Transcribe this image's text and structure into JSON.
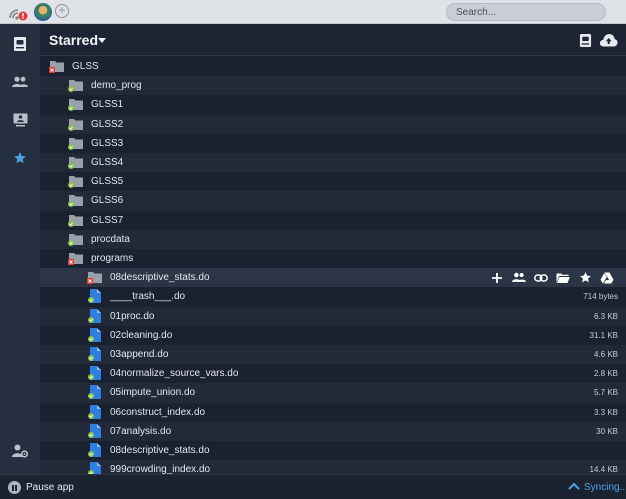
{
  "app": {
    "search": {
      "placeholder": "Search...",
      "value": ""
    }
  },
  "header": {
    "title": "Starred"
  },
  "rows": [
    {
      "label": "GLSS",
      "type": "folder",
      "status": "error",
      "size": ""
    },
    {
      "label": "demo_prog",
      "type": "folder",
      "status": "ok",
      "size": ""
    },
    {
      "label": "GLSS1",
      "type": "folder",
      "status": "ok",
      "size": ""
    },
    {
      "label": "GLSS2",
      "type": "folder",
      "status": "ok",
      "size": ""
    },
    {
      "label": "GLSS3",
      "type": "folder",
      "status": "ok",
      "size": ""
    },
    {
      "label": "GLSS4",
      "type": "folder",
      "status": "ok",
      "size": ""
    },
    {
      "label": "GLSS5",
      "type": "folder",
      "status": "ok",
      "size": ""
    },
    {
      "label": "GLSS6",
      "type": "folder",
      "status": "ok",
      "size": ""
    },
    {
      "label": "GLSS7",
      "type": "folder",
      "status": "ok",
      "size": ""
    },
    {
      "label": "procdata",
      "type": "folder",
      "status": "ok",
      "size": ""
    },
    {
      "label": "programs",
      "type": "folder",
      "status": "error",
      "size": ""
    },
    {
      "label": "08descriptive_stats.do",
      "type": "folder",
      "status": "error",
      "size": ""
    },
    {
      "label": "____trash___.do",
      "type": "file",
      "status": "ok",
      "size": "714 bytes"
    },
    {
      "label": "01proc.do",
      "type": "file",
      "status": "ok",
      "size": "6.3 KB"
    },
    {
      "label": "02cleaning.do",
      "type": "file",
      "status": "ok",
      "size": "31.1 KB"
    },
    {
      "label": "03append.do",
      "type": "file",
      "status": "ok",
      "size": "4.6 KB"
    },
    {
      "label": "04normalize_source_vars.do",
      "type": "file",
      "status": "ok",
      "size": "2.8 KB"
    },
    {
      "label": "05impute_union.do",
      "type": "file",
      "status": "ok",
      "size": "5.7 KB"
    },
    {
      "label": "06construct_index.do",
      "type": "file",
      "status": "ok",
      "size": "3.3 KB"
    },
    {
      "label": "07analysis.do",
      "type": "file",
      "status": "ok",
      "size": "30 KB"
    },
    {
      "label": "08descriptive_stats.do",
      "type": "file",
      "status": "ok",
      "size": ""
    },
    {
      "label": "999crowding_index.do",
      "type": "file",
      "status": "ok",
      "size": "14.4 KB"
    }
  ],
  "footer": {
    "pause_label": "Pause app",
    "sync_label": "Syncing..."
  },
  "colors": {
    "accent": "#4ba3e6",
    "ok": "#8bc34a",
    "error": "#e53935",
    "folder": "#9aa0a8",
    "file": "#2f7fe0"
  }
}
